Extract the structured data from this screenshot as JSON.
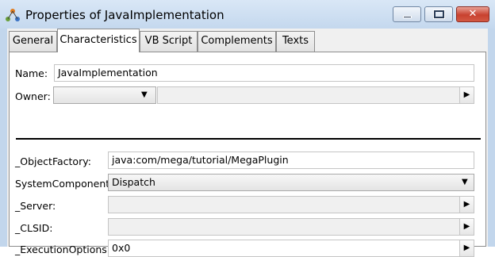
{
  "window": {
    "title": "Properties of JavaImplementation"
  },
  "tabs": [
    {
      "label": "General",
      "active": false
    },
    {
      "label": "Characteristics",
      "active": true
    },
    {
      "label": "VB Script",
      "active": false
    },
    {
      "label": "Complements",
      "active": false
    },
    {
      "label": "Texts",
      "active": false
    }
  ],
  "form": {
    "name": {
      "label": "Name:",
      "value": "JavaImplementation"
    },
    "owner": {
      "label": "Owner:",
      "value": ""
    },
    "object_factory": {
      "label": "_ObjectFactory:",
      "value": "java:com/mega/tutorial/MegaPlugin"
    },
    "system_component": {
      "label": "SystemComponent:",
      "value": "Dispatch"
    },
    "server": {
      "label": "_Server:",
      "value": ""
    },
    "clsid": {
      "label": "_CLSID:",
      "value": ""
    },
    "execution_options": {
      "label": "_ExecutionOptions:",
      "value": "0x0"
    }
  },
  "icons": {
    "app": "mega-app-icon",
    "dropdown": "chevron-down-icon",
    "browse": "triangle-right-icon"
  },
  "colors": {
    "titlebar": "#c4d8ee",
    "close": "#c8412f",
    "panel": "#ffffff"
  }
}
